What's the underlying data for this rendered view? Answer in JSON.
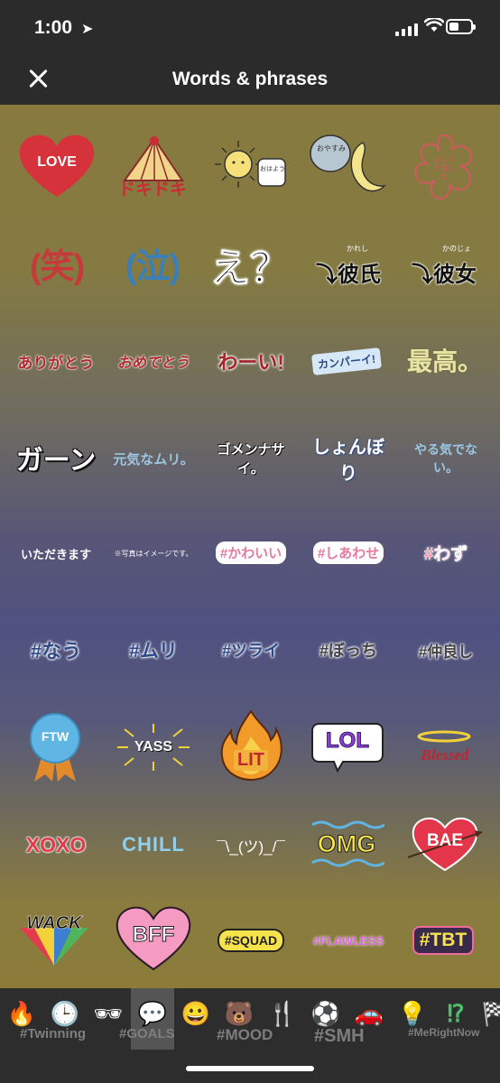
{
  "status": {
    "time": "1:00",
    "battery_level": 0.45
  },
  "header": {
    "title": "Words & phrases"
  },
  "stickers": {
    "love": "LOVE",
    "dokidoki": "ドキドキ",
    "ohayou": "おはよう",
    "oyasumi": "おやすみ",
    "sakura": "よくできました",
    "warai": "(笑)",
    "naki": "(泣)",
    "e": "え？",
    "kareshi_ruby": "かれし",
    "kareshi": "彼氏",
    "kanojo_ruby": "かのじょ",
    "kanojo": "彼女",
    "arigatou": "ありがとう",
    "omedetou": "おめでとう",
    "waai": "わーい!",
    "kanpai": "カンパーイ!",
    "saikou": "最高。",
    "gaan": "ガーン",
    "genkinamuri": "元気なムリ。",
    "gomennasai": "ゴメンナサイ。",
    "shonbori": "しょんぼり",
    "yarukinai": "やる気でない。",
    "itadakimasu": "いただきます",
    "shashin": "※写真はイメージです。",
    "kawaii": "#かわいい",
    "shiawase": "#しあわせ",
    "wazu": "#わず",
    "nau": "#なう",
    "muri": "#ムリ",
    "tsurai": "#ツライ",
    "bocchi": "#ぼっち",
    "nakayoshi": "#仲良し",
    "ftw": "FTW",
    "yass": "YASS",
    "lit": "LIT",
    "lol": "LOL",
    "blessed": "Blessed",
    "xoxo": "XOXO",
    "chill": "CHILL",
    "shrug": "¯\\_(ツ)_/¯",
    "omg": "OMG",
    "bae": "BAE",
    "wack": "WACK",
    "bff": "BFF",
    "squad": "#SQUAD",
    "flawless": "#FLAWLESS",
    "tbt": "#TBT"
  },
  "tabs": {
    "items": [
      "🔥",
      "🕒",
      "🕶",
      "💬",
      "😀",
      "🐻",
      "🍴",
      "⚽",
      "🚗",
      "💡",
      "⁉",
      "🏁"
    ],
    "sub_labels": [
      "#Twinning",
      "#GOALS",
      "#MOOD",
      "#SMH",
      "#MeRightNow"
    ]
  }
}
